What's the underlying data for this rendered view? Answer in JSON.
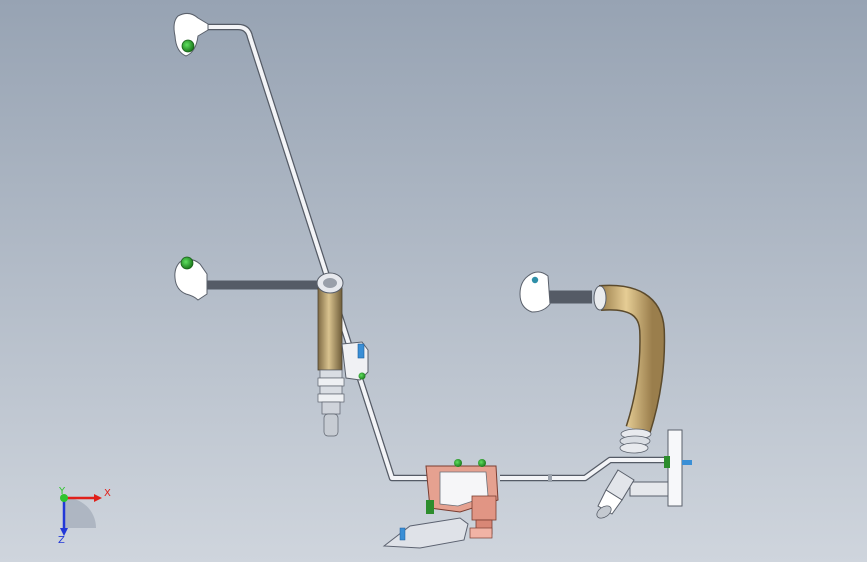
{
  "view": {
    "background_top": "#97a3b3",
    "background_bottom": "#cfd5dd"
  },
  "triad": {
    "x_label": "X",
    "y_label": "Y",
    "z_label": "Z",
    "x_color": "#e0201a",
    "y_color": "#2ec42e",
    "z_color": "#2238d8"
  },
  "parts": {
    "tube_color": "#eef0f4",
    "hose_color": "#cfae72",
    "fitting_copper": "#dc8c78",
    "grommet_green": "#2da62d",
    "screw_blue": "#3a8fd6"
  }
}
